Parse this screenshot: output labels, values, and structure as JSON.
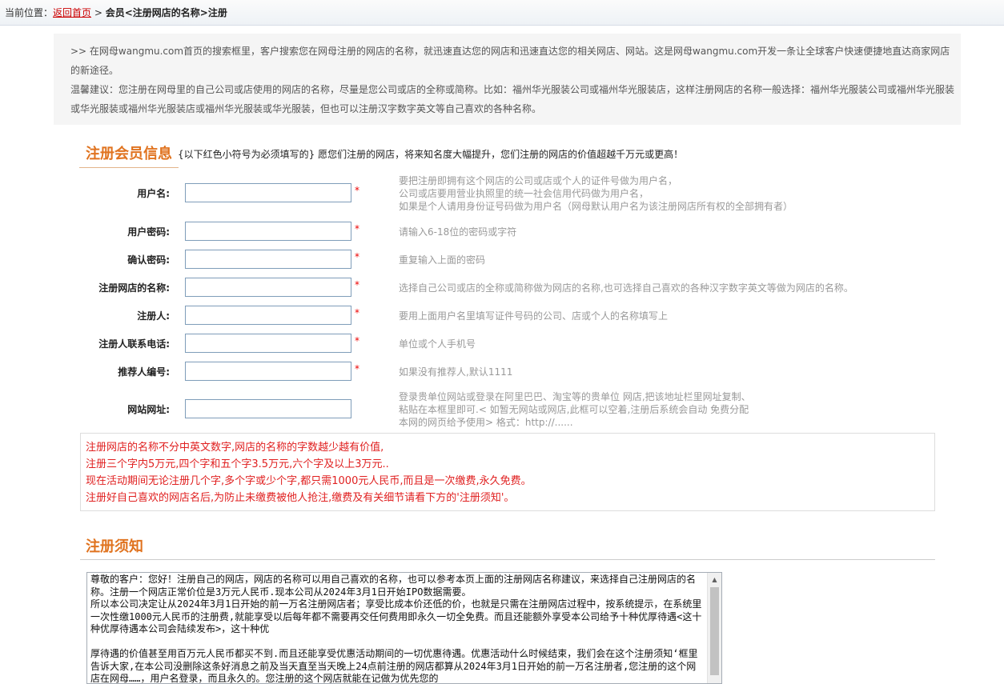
{
  "breadcrumb": {
    "prefix": "当前位置：",
    "home_link": "返回首页",
    "separator": " > ",
    "current": "会员<注册网店的名称>注册"
  },
  "intro": {
    "line1": ">> 在网母wangmu.com首页的搜索框里，客户搜索您在网母注册的网店的名称，就迅速直达您的网店和迅速直达您的相关网店、网站。这是网母wangmu.com开发一条让全球客户快速便捷地直达商家网店的新途径。",
    "line2": "温馨建议：您注册在网母里的自己公司或店使用的网店的名称，尽量是您公司或店的全称或简称。比如：福州华光服装公司或福州华光服装店，这样注册网店的名称一般选择：福州华光服装公司或福州华光服装或华光服装或福州华光服装店或福州华光服装或华光服装，但也可以注册汉字数字英文等自己喜欢的各种名称。"
  },
  "member_section": {
    "title": "注册会员信息",
    "note": "{以下红色小符号为必须填写的} 愿您们注册的网店，将来知名度大幅提升，您们注册的网店的价值超越千万元或更高！"
  },
  "required_mark": "*",
  "fields": [
    {
      "label": "用户名:",
      "value": "",
      "required": true,
      "hint": "要把注册即拥有这个网店的公司或店或个人的证件号做为用户名，\n公司或店要用营业执照里的统一社会信用代码做为用户名，\n如果是个人请用身份证号码做为用户名（网母默认用户名为该注册网店所有权的全部拥有者）"
    },
    {
      "label": "用户密码:",
      "value": "",
      "required": true,
      "hint": "请输入6-18位的密码或字符"
    },
    {
      "label": "确认密码:",
      "value": "",
      "required": true,
      "hint": "重复输入上面的密码"
    },
    {
      "label": "注册网店的名称:",
      "value": "",
      "required": true,
      "hint": "选择自己公司或店的全称或简称做为网店的名称,也可选择自己喜欢的各种汉字数字英文等做为网店的名称。"
    },
    {
      "label": "注册人:",
      "value": "",
      "required": true,
      "hint": "要用上面用户名里填写证件号码的公司、店或个人的名称填写上"
    },
    {
      "label": "注册人联系电话:",
      "value": "",
      "required": true,
      "hint": "单位或个人手机号"
    },
    {
      "label": "推荐人编号:",
      "value": "",
      "required": true,
      "hint": "如果没有推荐人,默认1111"
    },
    {
      "label": "网站网址:",
      "value": "",
      "required": false,
      "hint": "登录贵单位网站或登录在阿里巴巴、淘宝等的贵单位 网店,把该地址栏里网址复制、\n粘贴在本框里即可.< 如暂无网站或网店,此框可以空着,注册后系统会自动 免费分配\n本网的网页给予使用> 格式：http://......"
    }
  ],
  "notice": [
    "注册网店的名称不分中英文数字,网店的名称的字数越少越有价值,",
    "注册三个字内5万元,四个字和五个字3.5万元,六个字及以上3万元..",
    "现在活动期间无论注册几个字,多个字或少个字,都只需1000元人民币,而且是一次缴费,永久免费。",
    "注册好自己喜欢的网店名后,为防止未缴费被他人抢注,缴费及有关细节请看下方的'注册须知'。"
  ],
  "rules_section": {
    "title": "注册须知",
    "text": "尊敬的客户：您好！注册自己的网店，网店的名称可以用自己喜欢的名称，也可以参考本页上面的注册网店名称建议，来选择自己注册网店的名称。注册一个网店正常价位是3万元人民币.现本公司从2024年3月1日开始IPO数据需要。\n所以本公司决定让从2024年3月1日开始的前一万名注册网店者；享受比成本价还低的价，也就是只需在注册网店过程中，按系统提示，在系统里一次性缴1000元人民币的注册费,就能享受以后每年都不需要再交任何费用即永久一切全免费。而且还能额外享受本公司给予十种优厚待遇<这十种优厚待遇本公司会陆续发布>，这十种优\n\n厚待遇的价值甚至用百万元人民币都买不到.而且还能享受优惠活动期间的一切优惠待遇。优惠活动什么时候结束，我们会在这个注册须知‘框里告诉大家,在本公司没删除这条好消息之前及当天直至当天晚上24点前注册的网店都算从2024年3月1日开始的前一万名注册者,您注册的这个网店在网母……，用户名登录，而且永久的。您注册的这个网店就能在记做为优先您的"
  }
}
